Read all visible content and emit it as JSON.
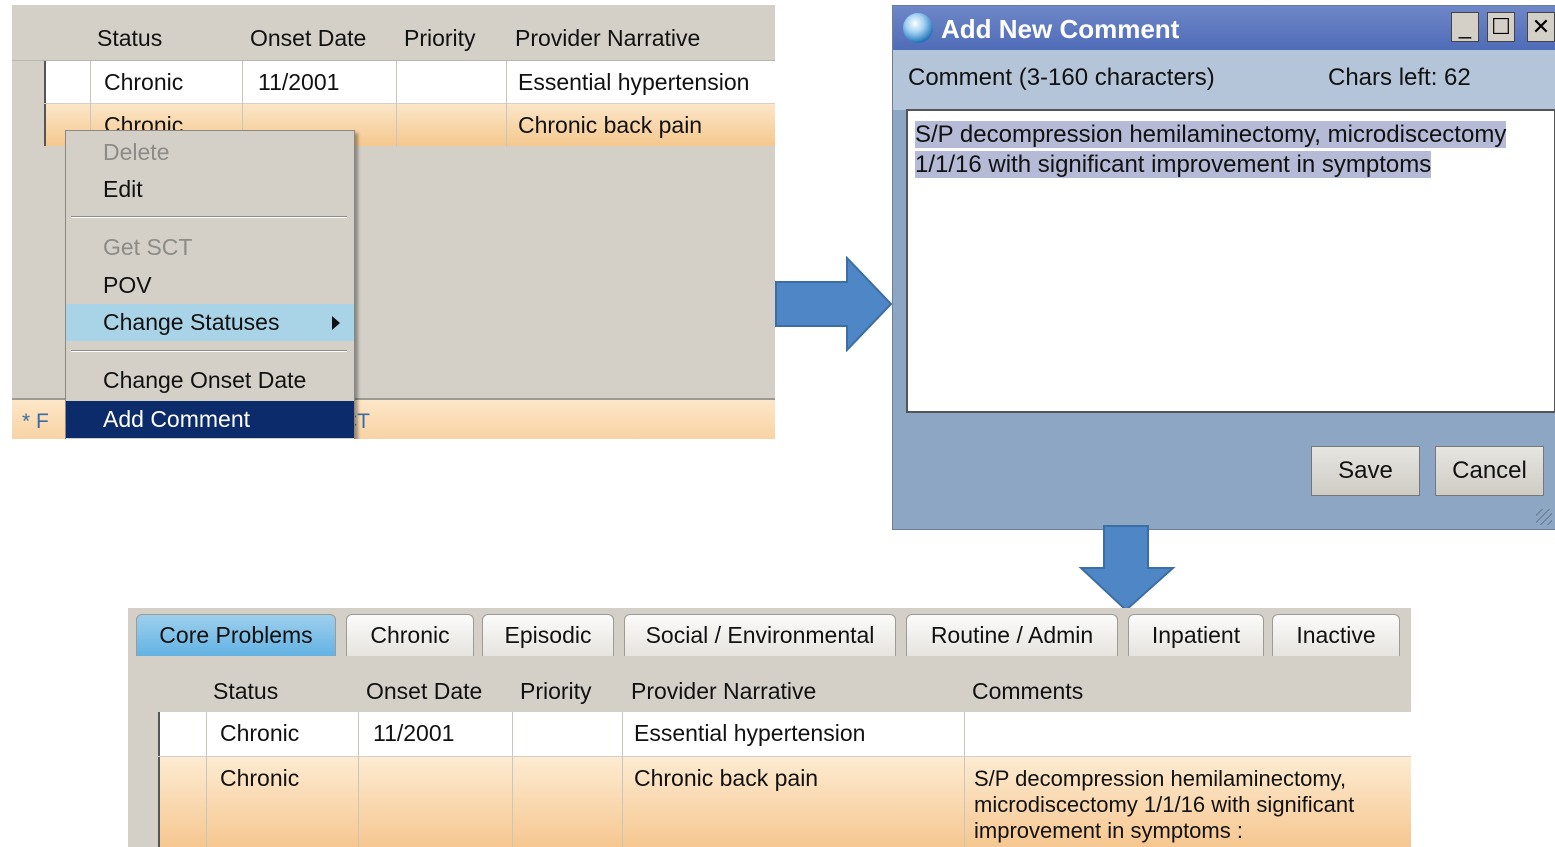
{
  "panel1": {
    "columns": [
      "Status",
      "Onset Date",
      "Priority",
      "Provider Narrative"
    ],
    "rows": [
      {
        "status": "Chronic",
        "onset": "11/2001",
        "priority": "",
        "narrative": "Essential hypertension"
      },
      {
        "status": "Chronic",
        "onset": "",
        "priority": "",
        "narrative": "Chronic back pain"
      }
    ],
    "footer_left": "* F",
    "footer_right": "CT"
  },
  "context_menu": {
    "items": [
      {
        "label": "Delete",
        "state": "disabled"
      },
      {
        "label": "Edit",
        "state": "normal"
      },
      {
        "label": "Get SCT",
        "state": "disabled"
      },
      {
        "label": "POV",
        "state": "normal"
      },
      {
        "label": "Change Statuses",
        "state": "hover",
        "submenu": true
      },
      {
        "label": "Change Onset Date",
        "state": "normal"
      },
      {
        "label": "Add Comment",
        "state": "selected"
      }
    ]
  },
  "dialog": {
    "title": "Add New Comment",
    "window_buttons": {
      "minimize": "_",
      "maximize": "☐",
      "close": "✕"
    },
    "comment_label": "Comment (3-160 characters)",
    "chars_left": "Chars left: 62",
    "comment_lines": [
      "S/P decompression hemilaminectomy, microdiscectomy",
      "1/1/16 with significant improvement in symptoms"
    ],
    "save_label": "Save",
    "cancel_label": "Cancel",
    "icon": "app-globe-icon"
  },
  "panel3": {
    "tabs": [
      {
        "label": "Core Problems",
        "active": true
      },
      {
        "label": "Chronic",
        "active": false
      },
      {
        "label": "Episodic",
        "active": false
      },
      {
        "label": "Social / Environmental",
        "active": false
      },
      {
        "label": "Routine / Admin",
        "active": false
      },
      {
        "label": "Inpatient",
        "active": false
      },
      {
        "label": "Inactive",
        "active": false
      }
    ],
    "columns": [
      "Status",
      "Onset Date",
      "Priority",
      "Provider Narrative",
      "Comments"
    ],
    "rows": [
      {
        "status": "Chronic",
        "onset": "11/2001",
        "priority": "",
        "narrative": "Essential hypertension",
        "comments": ""
      },
      {
        "status": "Chronic",
        "onset": "",
        "priority": "",
        "narrative": "Chronic back pain",
        "comments": "S/P decompression hemilaminectomy, microdiscectomy 1/1/16 with significant improvement in symptoms :"
      }
    ]
  },
  "colors": {
    "arrow_fill": "#4f86c6",
    "arrow_stroke": "#3a6ea5",
    "menu_selected": "#0b2b6a",
    "menu_hover": "#a9d3e6",
    "dialog_bg": "#8da6c4",
    "active_tab": "#62b2e3",
    "row_highlight": "#f6c790"
  }
}
